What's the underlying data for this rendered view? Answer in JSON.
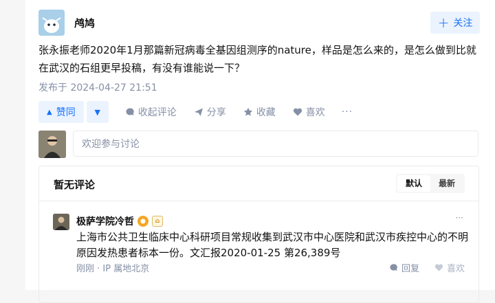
{
  "question": {
    "author": "鸬鸠",
    "follow_label": "关注",
    "content": "张永振老师2020年1月那篇新冠病毒全基因组测序的nature，样品是怎么来的，是怎么做到比就在武汉的石组更早投稿，有没有谁能说一下？",
    "published": "发布于 2024-04-27 21:51"
  },
  "actions": {
    "upvote": "赞同",
    "collapse_comments": "收起评论",
    "share": "分享",
    "favorite": "收藏",
    "like": "喜欢",
    "more": "···"
  },
  "comment_input": {
    "placeholder": "欢迎参与讨论"
  },
  "comments": {
    "title": "暂无评论",
    "sort": [
      "默认",
      "最新"
    ],
    "items": [
      {
        "author": "极萨学院冷哲",
        "text": "上海市公共卫生临床中心科研项目常规收集到武汉市中心医院和武汉市疾控中心的不明原因发热患者标本一份。文汇报2020-01-25 第26,389号",
        "time": "刚刚",
        "location": "IP 属地北京",
        "reply": "回复",
        "like": "喜欢",
        "more": "···"
      }
    ]
  },
  "colors": {
    "accent": "#1772f6",
    "accent_bg": "#ebf3ff",
    "muted": "#8590a6"
  }
}
